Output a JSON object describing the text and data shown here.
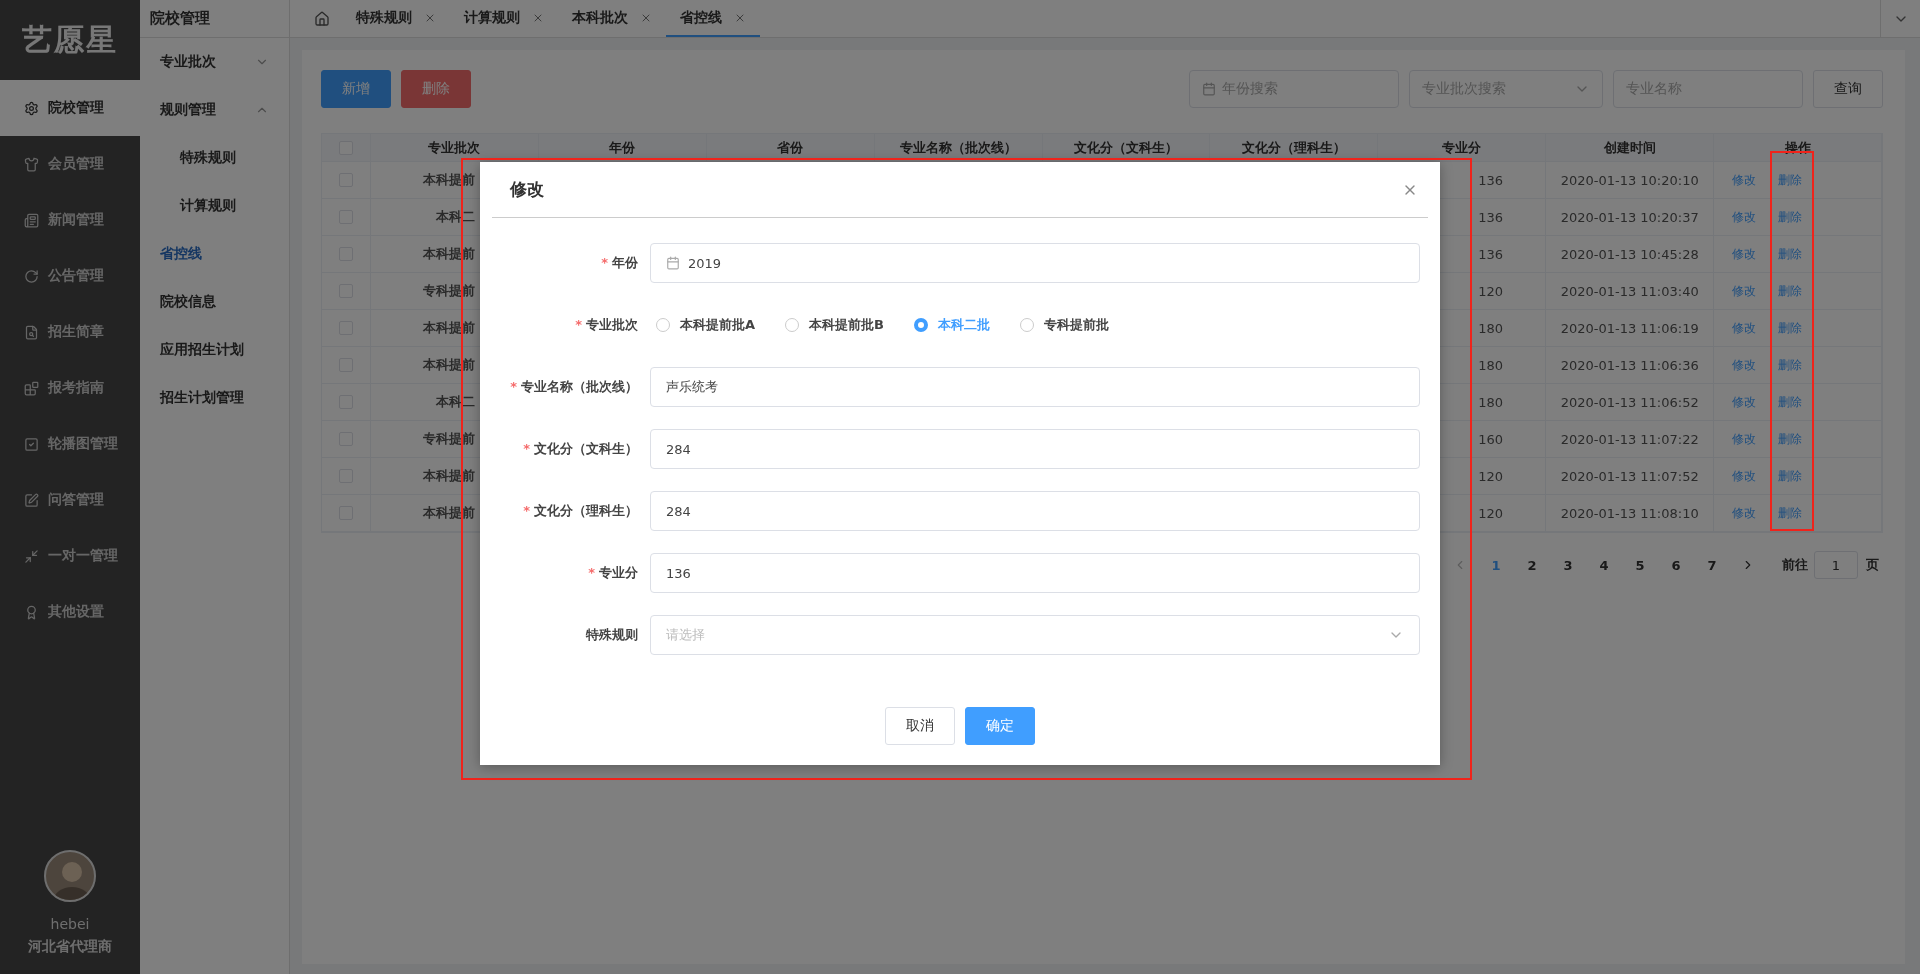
{
  "logo": "艺愿星",
  "nav": [
    {
      "label": "院校管理",
      "selected": true
    },
    {
      "label": "会员管理",
      "selected": false
    },
    {
      "label": "新闻管理",
      "selected": false
    },
    {
      "label": "公告管理",
      "selected": false
    },
    {
      "label": "招生简章",
      "selected": false
    },
    {
      "label": "报考指南",
      "selected": false
    },
    {
      "label": "轮播图管理",
      "selected": false
    },
    {
      "label": "问答管理",
      "selected": false
    },
    {
      "label": "一对一管理",
      "selected": false
    },
    {
      "label": "其他设置",
      "selected": false
    }
  ],
  "user": {
    "name": "hebei",
    "role": "河北省代理商"
  },
  "submenu": {
    "title": "院校管理",
    "items": [
      {
        "label": "专业批次",
        "selected": false,
        "expanded": false
      },
      {
        "label": "规则管理",
        "selected": false,
        "expanded": true,
        "children": [
          {
            "label": "特殊规则",
            "selected": false
          },
          {
            "label": "计算规则",
            "selected": false
          }
        ]
      },
      {
        "label": "省控线",
        "selected": true
      },
      {
        "label": "院校信息",
        "selected": false
      },
      {
        "label": "应用招生计划",
        "selected": false
      },
      {
        "label": "招生计划管理",
        "selected": false
      }
    ]
  },
  "tabs": [
    {
      "label": "特殊规则",
      "selected": false
    },
    {
      "label": "计算规则",
      "selected": false
    },
    {
      "label": "本科批次",
      "selected": false
    },
    {
      "label": "省控线",
      "selected": true
    }
  ],
  "toolbar": {
    "buttons": [
      {
        "label": "新增",
        "kind": "primary"
      },
      {
        "label": "删除",
        "kind": "danger"
      }
    ],
    "filters": [
      {
        "kind": "date",
        "placeholder": "年份搜索"
      },
      {
        "kind": "select",
        "placeholder": "专业批次搜索"
      },
      {
        "kind": "text",
        "placeholder": "专业名称"
      }
    ],
    "query": "查询"
  },
  "table": {
    "all_checked": false,
    "action_column_highlighted": true,
    "columns": [
      "专业批次",
      "年份",
      "省份",
      "专业名称（批次线）",
      "文化分（文科生）",
      "文化分（理科生）",
      "专业分",
      "创建时间",
      "操作"
    ],
    "rows": [
      {
        "checked": false,
        "batch": "本科提前",
        "score": "136",
        "created": "2020-01-13 10:20:10",
        "actions": [
          "修改",
          "删除"
        ]
      },
      {
        "checked": false,
        "batch": "本科二",
        "score": "136",
        "created": "2020-01-13 10:20:37",
        "actions": [
          "修改",
          "删除"
        ]
      },
      {
        "checked": false,
        "batch": "本科提前",
        "score": "136",
        "created": "2020-01-13 10:45:28",
        "actions": [
          "修改",
          "删除"
        ]
      },
      {
        "checked": false,
        "batch": "专科提前",
        "score": "120",
        "created": "2020-01-13 11:03:40",
        "actions": [
          "修改",
          "删除"
        ]
      },
      {
        "checked": false,
        "batch": "本科提前",
        "score": "180",
        "created": "2020-01-13 11:06:19",
        "actions": [
          "修改",
          "删除"
        ]
      },
      {
        "checked": false,
        "batch": "本科提前",
        "score": "180",
        "created": "2020-01-13 11:06:36",
        "actions": [
          "修改",
          "删除"
        ]
      },
      {
        "checked": false,
        "batch": "本科二",
        "score": "180",
        "created": "2020-01-13 11:06:52",
        "actions": [
          "修改",
          "删除"
        ]
      },
      {
        "checked": false,
        "batch": "专科提前",
        "score": "160",
        "created": "2020-01-13 11:07:22",
        "actions": [
          "修改",
          "删除"
        ]
      },
      {
        "checked": false,
        "batch": "本科提前",
        "score": "120",
        "created": "2020-01-13 11:07:52",
        "actions": [
          "修改",
          "删除"
        ]
      },
      {
        "checked": false,
        "batch": "本科提前",
        "score": "120",
        "created": "2020-01-13 11:08:10",
        "actions": [
          "修改",
          "删除"
        ]
      }
    ]
  },
  "pagination": {
    "pages": [
      {
        "label": "1",
        "selected": true
      },
      {
        "label": "2",
        "selected": false
      },
      {
        "label": "3",
        "selected": false
      },
      {
        "label": "4",
        "selected": false
      },
      {
        "label": "5",
        "selected": false
      },
      {
        "label": "6",
        "selected": false
      },
      {
        "label": "7",
        "selected": false
      }
    ],
    "goto_label": "前往",
    "page_input": "1",
    "page_suffix": "页"
  },
  "dialog": {
    "highlighted": true,
    "title": "修改",
    "fields": [
      {
        "kind": "date",
        "label": "年份",
        "marker": "*",
        "value": "2019"
      },
      {
        "kind": "radio",
        "label": "专业批次",
        "marker": "*",
        "options": [
          {
            "label": "本科提前批A",
            "selected": false
          },
          {
            "label": "本科提前批B",
            "selected": false
          },
          {
            "label": "本科二批",
            "selected": true
          },
          {
            "label": "专科提前批",
            "selected": false
          }
        ]
      },
      {
        "kind": "text",
        "label": "专业名称（批次线）",
        "marker": "*",
        "value": "声乐统考"
      },
      {
        "kind": "text",
        "label": "文化分（文科生）",
        "marker": "*",
        "value": "284"
      },
      {
        "kind": "text",
        "label": "文化分（理科生）",
        "marker": "*",
        "value": "284"
      },
      {
        "kind": "text",
        "label": "专业分",
        "marker": "*",
        "value": "136"
      },
      {
        "kind": "select",
        "label": "特殊规则",
        "placeholder": "请选择"
      }
    ],
    "buttons": [
      {
        "label": "取消",
        "kind": "default"
      },
      {
        "label": "确定",
        "kind": "primary"
      }
    ]
  }
}
